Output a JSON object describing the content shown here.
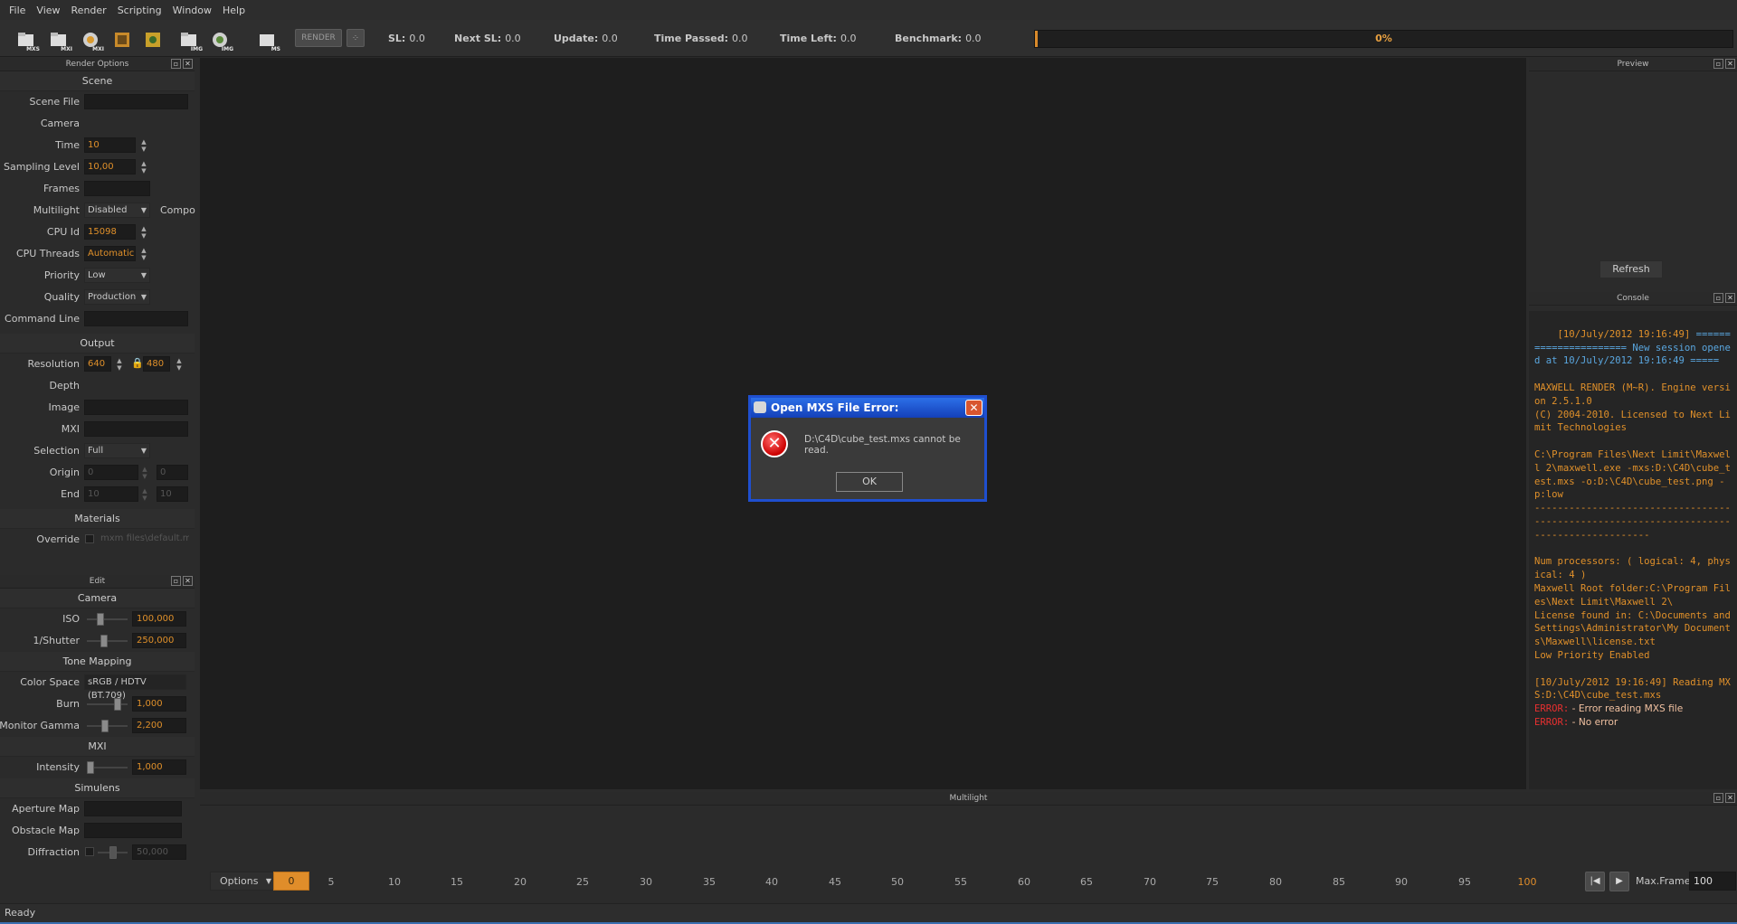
{
  "menu": [
    "File",
    "View",
    "Render",
    "Scripting",
    "Window",
    "Help"
  ],
  "toolbar": {
    "icons": [
      {
        "name": "open-mxs-icon",
        "label": "MXS"
      },
      {
        "name": "open-mxi-icon",
        "label": "MXI"
      },
      {
        "name": "mxi-sphere-icon",
        "label": "MXI"
      },
      {
        "name": "film-sequence-icon",
        "label": ""
      },
      {
        "name": "film-render-icon",
        "label": ""
      },
      {
        "name": "save-img-icon",
        "label": "IMG"
      },
      {
        "name": "img-sphere-icon",
        "label": "IMG"
      },
      {
        "name": "ms-script-icon",
        "label": "MS"
      }
    ],
    "render_label": "RENDER",
    "stats": {
      "sl_label": "SL:",
      "sl_value": "0.0",
      "next_sl_label": "Next SL:",
      "next_sl_value": "0.0",
      "update_label": "Update:",
      "update_value": "0.0",
      "time_passed_label": "Time Passed:",
      "time_passed_value": "0.0",
      "time_left_label": "Time Left:",
      "time_left_value": "0.0",
      "benchmark_label": "Benchmark:",
      "benchmark_value": "0.0"
    },
    "progress_text": "0%",
    "progress_fraction": 0.0
  },
  "render_options": {
    "title": "Render Options",
    "scene_head": "Scene",
    "scene_file_label": "Scene File",
    "scene_file": "",
    "camera_label": "Camera",
    "time_label": "Time",
    "time": "10",
    "sampling_label": "Sampling Level",
    "sampling": "10,00",
    "frames_label": "Frames",
    "frames": "",
    "multilight_label": "Multilight",
    "multilight": "Disabled",
    "multilight_extra": "Compo",
    "cpu_id_label": "CPU Id",
    "cpu_id": "15098",
    "cpu_threads_label": "CPU Threads",
    "cpu_threads": "Automatic",
    "priority_label": "Priority",
    "priority": "Low",
    "quality_label": "Quality",
    "quality": "Production",
    "command_line_label": "Command Line",
    "command_line": "",
    "output_head": "Output",
    "resolution_label": "Resolution",
    "res_w": "640",
    "res_h": "480",
    "depth_label": "Depth",
    "image_label": "Image",
    "mxi_label": "MXI",
    "selection_label": "Selection",
    "selection": "Full",
    "origin_label": "Origin",
    "origin_x": "0",
    "origin_y": "0",
    "end_label": "End",
    "end_x": "10",
    "end_y": "10",
    "materials_head": "Materials",
    "override_label": "Override",
    "override_path": "mxm files\\default.mxm"
  },
  "edit": {
    "title": "Edit",
    "camera_head": "Camera",
    "iso_label": "ISO",
    "iso": "100,000",
    "iso_pos": 0.3,
    "shutter_label": "1/Shutter",
    "shutter": "250,000",
    "shutter_pos": 0.4,
    "tone_head": "Tone Mapping",
    "color_space_label": "Color Space",
    "color_space": "sRGB / HDTV (BT.709)",
    "burn_label": "Burn",
    "burn": "1,000",
    "burn_pos": 0.8,
    "gamma_label": "Monitor Gamma",
    "gamma": "2,200",
    "gamma_pos": 0.44,
    "mxi_head": "MXI",
    "intensity_label": "Intensity",
    "intensity": "1,000",
    "intensity_pos": 0.0,
    "simulens_head": "Simulens",
    "aperture_label": "Aperture Map",
    "obstacle_label": "Obstacle Map",
    "diffraction_label": "Diffraction",
    "diffraction": "50,000",
    "diffraction_pos": 0.5
  },
  "preview": {
    "title": "Preview",
    "refresh_label": "Refresh"
  },
  "console": {
    "title": "Console",
    "lines": [
      {
        "cls": "c-orange",
        "text": "[10/July/2012 19:16:49]"
      },
      {
        "cls": "c-blue",
        "text": " ====================== New session opened at 10/July/2012 19:16:49 =====\n\n"
      },
      {
        "cls": "c-orange",
        "text": "MAXWELL RENDER (M~R). Engine version 2.5.1.0\n(C) 2004-2010. Licensed to Next Limit Technologies\n\nC:\\Program Files\\Next Limit\\Maxwell 2\\maxwell.exe -mxs:D:\\C4D\\cube_test.mxs -o:D:\\C4D\\cube_test.png -p:low\n----------------------------------------------------------------------------------------\n\nNum processors: ( logical: 4, physical: 4 )\nMaxwell Root folder:C:\\Program Files\\Next Limit\\Maxwell 2\\\nLicense found in: C:\\Documents and Settings\\Administrator\\My Documents\\Maxwell\\license.txt\nLow Priority Enabled\n\n[10/July/2012 19:16:49] Reading MXS:D:\\C4D\\cube_test.mxs\n"
      },
      {
        "cls": "c-red",
        "text": "ERROR:"
      },
      {
        "cls": "c-white",
        "text": " - Error reading MXS file\n"
      },
      {
        "cls": "c-red",
        "text": "ERROR:"
      },
      {
        "cls": "c-white",
        "text": " - No error"
      }
    ]
  },
  "multilight": {
    "title": "Multilight",
    "options_label": "Options",
    "current_frame": "0",
    "ticks": [
      "5",
      "10",
      "15",
      "20",
      "25",
      "30",
      "35",
      "40",
      "45",
      "50",
      "55",
      "60",
      "65",
      "70",
      "75",
      "80",
      "85",
      "90",
      "95",
      "100"
    ],
    "max_frames_label": "Max.Frames",
    "max_frames": "100"
  },
  "status": "Ready",
  "dialog": {
    "title": "Open MXS File Error:",
    "message": "D:\\C4D\\cube_test.mxs cannot be read.",
    "ok_label": "OK"
  },
  "colors": {
    "accent": "#e0902a",
    "console_blue": "#5aa7e0",
    "error_red": "#e83030",
    "dialog_blue": "#1f4fcf"
  }
}
